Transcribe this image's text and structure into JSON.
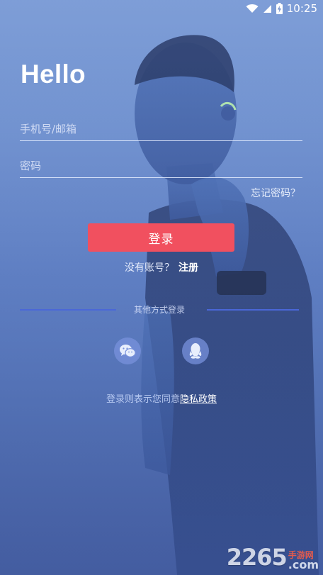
{
  "status_bar": {
    "time": "10:25",
    "icons": [
      "wifi-icon",
      "signal-icon",
      "battery-charging-icon"
    ]
  },
  "hello": "Hello",
  "form": {
    "account_placeholder": "手机号/邮箱",
    "password_placeholder": "密码",
    "account_value": "",
    "password_value": "",
    "forgot_password": "忘记密码？",
    "login_label": "登录"
  },
  "register": {
    "prompt": "没有账号？",
    "link": "注册"
  },
  "other_login": {
    "label": "其他方式登录",
    "options": [
      "wechat-icon",
      "qq-icon"
    ]
  },
  "privacy": {
    "prefix": "登录则表示您同意",
    "link": "隐私政策"
  },
  "watermark": {
    "number": "2265",
    "cn": "手游网",
    "com": ".com"
  },
  "colors": {
    "accent_button": "#f1505f",
    "divider": "#4a67d8",
    "background_top": "#7f9fd7",
    "background_bottom": "#465fa0"
  }
}
